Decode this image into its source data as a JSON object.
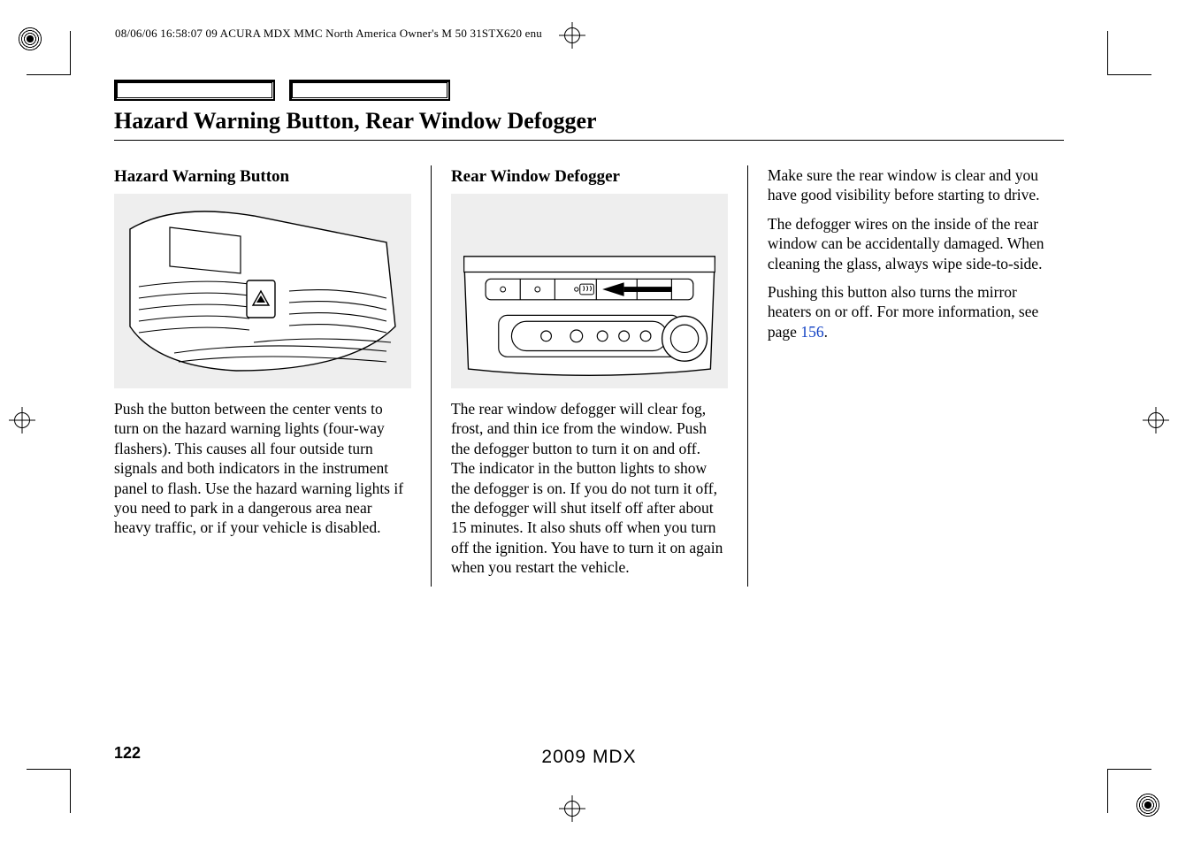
{
  "meta_header": "08/06/06 16:58:07   09 ACURA MDX MMC North America Owner's M 50 31STX620 enu",
  "main_title": "Hazard Warning Button, Rear Window Defogger",
  "col1": {
    "heading": "Hazard Warning Button",
    "para1": "Push the button between the center vents to turn on the hazard warning lights (four-way flashers). This causes all four outside turn signals and both indicators in the instrument panel to flash. Use the hazard warning lights if you need to park in a dangerous area near heavy traffic, or if your vehicle is disabled."
  },
  "col2": {
    "heading": "Rear Window Defogger",
    "para1": "The rear window defogger will clear fog, frost, and thin ice from the window. Push the defogger button to turn it on and off. The indicator in the button lights to show the defogger is on. If you do not turn it off, the defogger will shut itself off after about 15 minutes. It also shuts off when you turn off the ignition. You have to turn it on again when you restart the vehicle."
  },
  "col3": {
    "para1": "Make sure the rear window is clear and you have good visibility before starting to drive.",
    "para2": "The defogger wires on the inside of the rear window can be accidentally damaged. When cleaning the glass, always wipe side-to-side.",
    "para3_a": "Pushing this button also turns the mirror heaters on or off. For more information, see page ",
    "para3_ref": "156",
    "para3_b": "."
  },
  "page_number": "122",
  "footer_model": "2009  MDX"
}
